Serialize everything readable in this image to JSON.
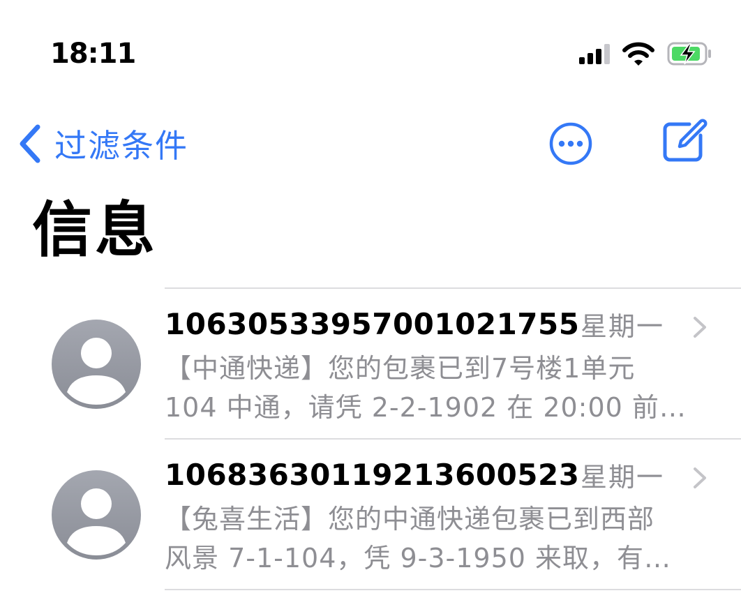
{
  "status_bar": {
    "time": "18:11",
    "icons": [
      "cellular-signal-icon",
      "wifi-icon",
      "battery-charging-icon"
    ]
  },
  "nav": {
    "back_label": "过滤条件",
    "more_icon": "ellipsis-circle-icon",
    "compose_icon": "compose-icon"
  },
  "title": "信息",
  "colors": {
    "accent": "#3478f6",
    "secondary_text": "#8e8e93",
    "avatar": "#9a9da6",
    "separator": "#dcdcdf"
  },
  "messages": [
    {
      "sender": "106305339570010217​55",
      "date": "星期一",
      "preview_line1": "【中通快递】您的包裹已到7号楼1单元",
      "preview_line2": "104 中通，请凭 2-2-1902 在 20:00 前…"
    },
    {
      "sender": "10683630119213600523",
      "date": "星期一",
      "preview_line1": "【兔喜生活】您的中通快递包裹已到西部",
      "preview_line2": "风景 7-1-104，凭 9-3-1950 来取，有…"
    }
  ]
}
